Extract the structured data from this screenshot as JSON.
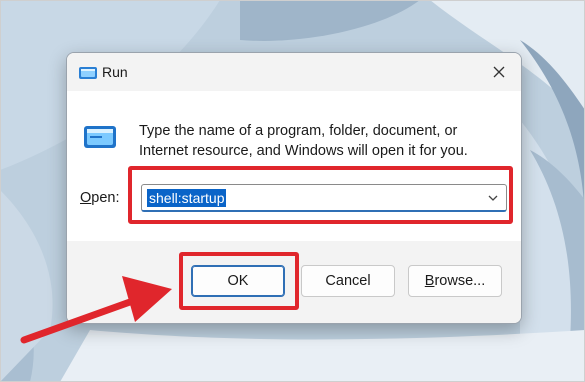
{
  "window": {
    "title": "Run",
    "icon": "run-icon"
  },
  "content": {
    "description_line1": "Type the name of a program, folder, document, or",
    "description_line2": "Internet resource, and Windows will open it for you.",
    "open_label_accel": "O",
    "open_label_rest": "pen:",
    "open_value": "shell:startup"
  },
  "buttons": {
    "ok": "OK",
    "cancel": "Cancel",
    "browse_accel": "B",
    "browse_rest": "rowse..."
  },
  "annotations": {
    "highlight_color": "#e0262c"
  },
  "colors": {
    "accent": "#0a64c8",
    "focus_border": "#2f6fb5"
  }
}
